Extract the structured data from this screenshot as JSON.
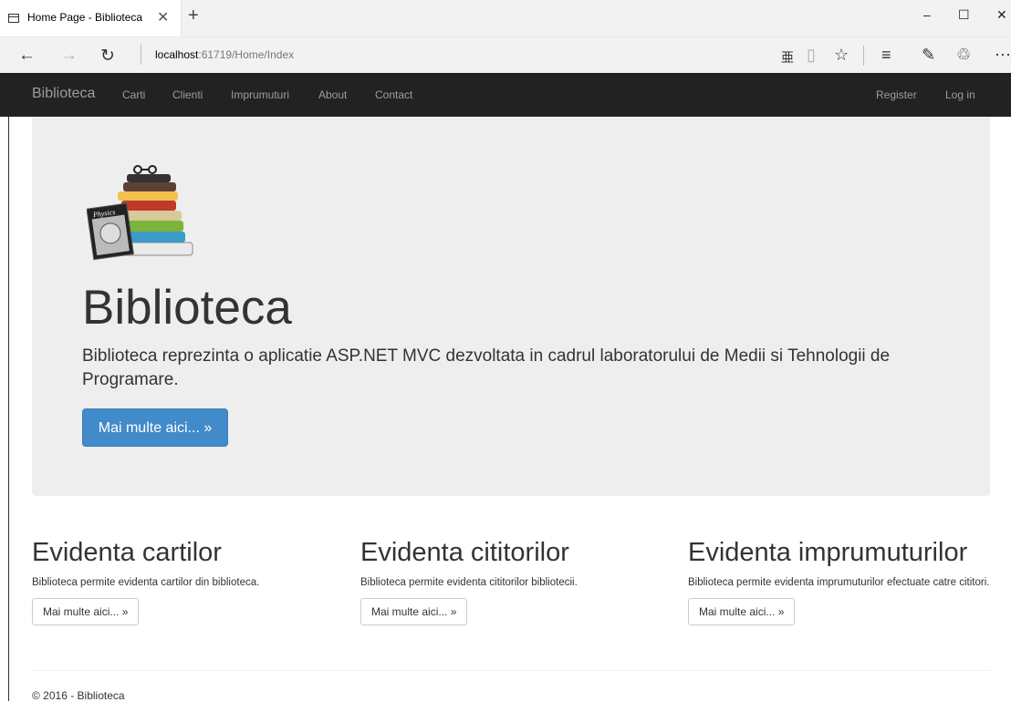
{
  "browser": {
    "tab_title": "Home Page - Biblioteca",
    "tab_close": "✕",
    "new_tab": "+",
    "url_host": "localhost",
    "url_rest": ":61719/Home/Index",
    "window_controls": {
      "minimize": "–",
      "maximize": "☐",
      "close": "✕"
    }
  },
  "navbar": {
    "brand": "Biblioteca",
    "links": [
      "Carti",
      "Clienti",
      "Imprumuturi",
      "About",
      "Contact"
    ],
    "right_links": [
      "Register",
      "Log in"
    ]
  },
  "jumbotron": {
    "book_label": "Physics",
    "title": "Biblioteca",
    "lead": "Biblioteca reprezinta o aplicatie ASP.NET MVC dezvoltata in cadrul laboratorului de Medii si Tehnologii de Programare.",
    "button": "Mai multe aici... »"
  },
  "columns": [
    {
      "title": "Evidenta cartilor",
      "text": "Biblioteca permite evidenta cartilor din biblioteca.",
      "button": "Mai multe aici... »"
    },
    {
      "title": "Evidenta cititorilor",
      "text": "Biblioteca permite evidenta cititorilor bibliotecii.",
      "button": "Mai multe aici... »"
    },
    {
      "title": "Evidenta imprumuturilor",
      "text": "Biblioteca permite evidenta imprumuturilor efectuate catre cititori.",
      "button": "Mai multe aici... »"
    }
  ],
  "footer": "© 2016 - Biblioteca",
  "colors": {
    "navbar": "#222222",
    "jumbotron": "#eeeeee",
    "primary": "#428bca",
    "nav_text": "#9d9d9d"
  }
}
